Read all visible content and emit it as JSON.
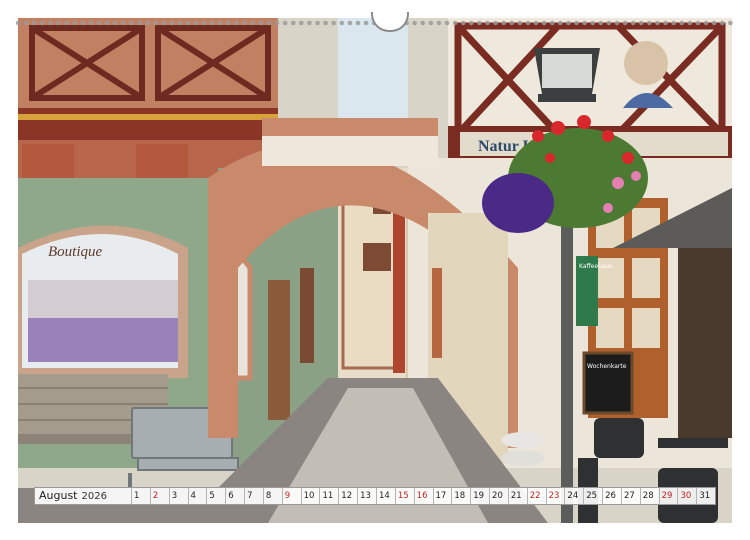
{
  "calendar": {
    "month": "August",
    "year": "2026",
    "days": [
      {
        "n": "1",
        "sun": false
      },
      {
        "n": "2",
        "sun": true
      },
      {
        "n": "3",
        "sun": false
      },
      {
        "n": "4",
        "sun": false
      },
      {
        "n": "5",
        "sun": false
      },
      {
        "n": "6",
        "sun": false
      },
      {
        "n": "7",
        "sun": false
      },
      {
        "n": "8",
        "sun": false
      },
      {
        "n": "9",
        "sun": true
      },
      {
        "n": "10",
        "sun": false
      },
      {
        "n": "11",
        "sun": false
      },
      {
        "n": "12",
        "sun": false
      },
      {
        "n": "13",
        "sun": false
      },
      {
        "n": "14",
        "sun": false
      },
      {
        "n": "15",
        "sun": true
      },
      {
        "n": "16",
        "sun": true
      },
      {
        "n": "17",
        "sun": false
      },
      {
        "n": "18",
        "sun": false
      },
      {
        "n": "19",
        "sun": false
      },
      {
        "n": "20",
        "sun": false
      },
      {
        "n": "21",
        "sun": false
      },
      {
        "n": "22",
        "sun": true
      },
      {
        "n": "23",
        "sun": true
      },
      {
        "n": "24",
        "sun": false
      },
      {
        "n": "25",
        "sun": false
      },
      {
        "n": "26",
        "sun": false
      },
      {
        "n": "27",
        "sun": false
      },
      {
        "n": "28",
        "sun": false
      },
      {
        "n": "29",
        "sun": true
      },
      {
        "n": "30",
        "sun": true
      },
      {
        "n": "31",
        "sun": false
      }
    ]
  },
  "photo": {
    "shop_sign": "Boutique",
    "building_sign": "Natur Konditorei",
    "green_sign": "Kaffeehaus",
    "chalkboard": "Wochenkarte"
  },
  "colors": {
    "sandstone": "#c98a6c",
    "plaster_green": "#8fa88a",
    "timber": "#7a2c22",
    "plaster_white": "#efe9dd",
    "sunday_red": "#c0231f"
  }
}
